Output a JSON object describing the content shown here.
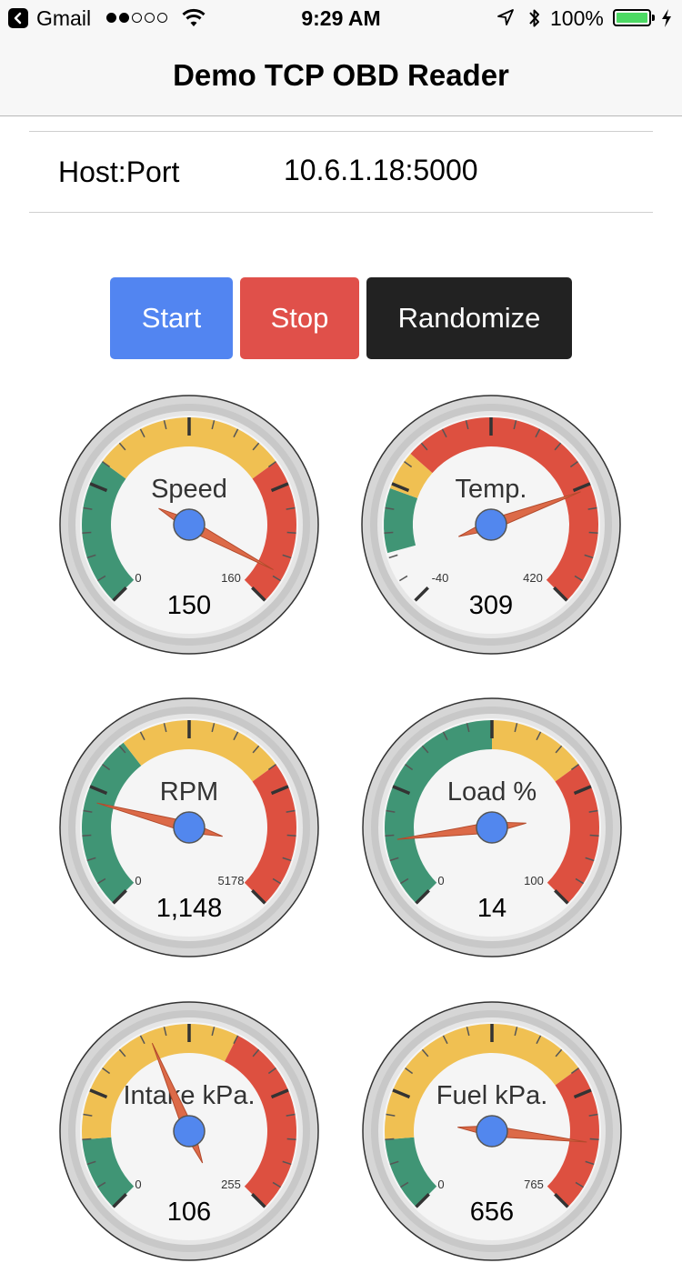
{
  "status_bar": {
    "carrier": "Gmail",
    "signal_bars": [
      1,
      1,
      0,
      0,
      0
    ],
    "time": "9:29 AM",
    "battery": "100%"
  },
  "nav": {
    "title": "Demo TCP OBD Reader"
  },
  "connection": {
    "label": "Host:Port",
    "value": "10.6.1.18:5000"
  },
  "buttons": {
    "start": "Start",
    "stop": "Stop",
    "randomize": "Randomize"
  },
  "colors": {
    "start": "#5285f1",
    "stop": "#e0504a",
    "randomize": "#222222",
    "green_band": "#409575",
    "yellow_band": "#f0c052",
    "red_band": "#dd5040",
    "needle": "#dc6a48",
    "hub": "#5287ee"
  },
  "gauges": [
    {
      "label": "Speed",
      "min": 0,
      "max": 160,
      "value": 150,
      "min_label": "0",
      "max_label": "160",
      "value_label": "150",
      "bands": [
        {
          "color": "green",
          "from": 0,
          "to": 0.3
        },
        {
          "color": "yellow",
          "from": 0.3,
          "to": 0.7
        },
        {
          "color": "red",
          "from": 0.7,
          "to": 1
        }
      ]
    },
    {
      "label": "Temp.",
      "min": -40,
      "max": 420,
      "value": 309,
      "min_label": "-40",
      "max_label": "420",
      "value_label": "309",
      "bands": [
        {
          "color": "green",
          "from": 0.11,
          "to": 0.24
        },
        {
          "color": "yellow",
          "from": 0.24,
          "to": 0.32
        },
        {
          "color": "red",
          "from": 0.32,
          "to": 1
        }
      ]
    },
    {
      "label": "RPM",
      "min": 0,
      "max": 5178,
      "value": 1148,
      "min_label": "0",
      "max_label": "5178",
      "value_label": "1,148",
      "bands": [
        {
          "color": "green",
          "from": 0,
          "to": 0.36
        },
        {
          "color": "yellow",
          "from": 0.36,
          "to": 0.7
        },
        {
          "color": "red",
          "from": 0.7,
          "to": 1
        }
      ]
    },
    {
      "label": "Load %",
      "min": 0,
      "max": 100,
      "value": 14,
      "min_label": "0",
      "max_label": "100",
      "value_label": "14",
      "bands": [
        {
          "color": "green",
          "from": 0,
          "to": 0.5
        },
        {
          "color": "yellow",
          "from": 0.5,
          "to": 0.7
        },
        {
          "color": "red",
          "from": 0.7,
          "to": 1
        }
      ]
    },
    {
      "label": "Intake kPa.",
      "min": 0,
      "max": 255,
      "value": 106,
      "min_label": "0",
      "max_label": "255",
      "value_label": "106",
      "bands": [
        {
          "color": "green",
          "from": 0,
          "to": 0.15
        },
        {
          "color": "yellow",
          "from": 0.15,
          "to": 0.6
        },
        {
          "color": "red",
          "from": 0.6,
          "to": 1
        }
      ]
    },
    {
      "label": "Fuel kPa.",
      "min": 0,
      "max": 765,
      "value": 656,
      "min_label": "0",
      "max_label": "765",
      "value_label": "656",
      "bands": [
        {
          "color": "green",
          "from": 0,
          "to": 0.15
        },
        {
          "color": "yellow",
          "from": 0.15,
          "to": 0.7
        },
        {
          "color": "red",
          "from": 0.7,
          "to": 1
        }
      ]
    }
  ]
}
